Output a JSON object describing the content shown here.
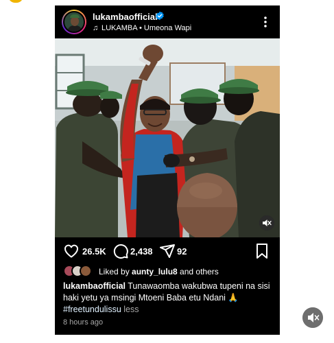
{
  "post": {
    "username": "lukambaofficial",
    "audio": "LUKAMBA • Umeona Wapi",
    "likes": "26.5K",
    "comments": "2,438",
    "shares": "92",
    "liked_by_prefix": "Liked by ",
    "liked_by_user": "aunty_lulu8",
    "liked_by_suffix": " and others",
    "caption_user": "lukambaofficial",
    "caption_text": " Tunawaomba wakubwa tupeni  na sisi haki yetu ya msingi Mtoeni Baba etu Ndani 🙏",
    "hashtag": "#freetundulissu",
    "less": " less",
    "timestamp": "8 hours ago"
  },
  "icons": {
    "verified": "verified-badge-icon",
    "music": "music-note-icon",
    "more": "more-options-icon",
    "like": "heart-icon",
    "comment": "comment-icon",
    "share": "send-icon",
    "save": "bookmark-icon",
    "mute": "speaker-muted-icon"
  },
  "colors": {
    "card_bg": "#000000",
    "verified": "#0095f6",
    "secondary_text": "#a8a8a8"
  }
}
